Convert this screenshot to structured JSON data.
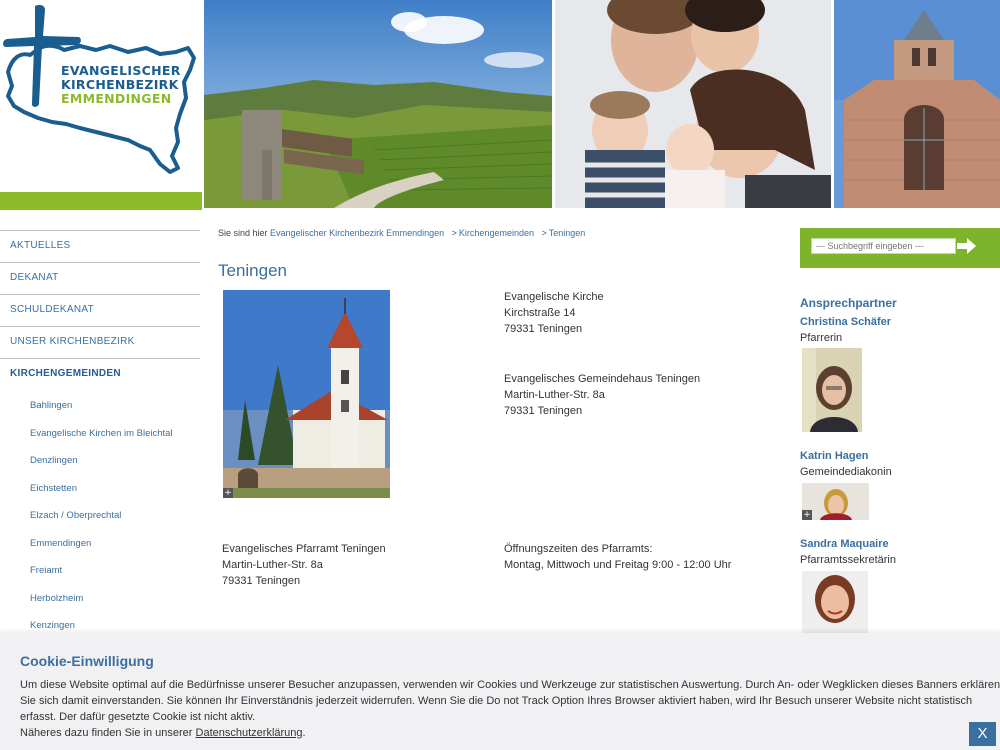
{
  "logo": {
    "line1": "EVANGELISCHER",
    "line2": "KIRCHENBEZIRK",
    "line3": "EMMENDINGEN"
  },
  "nav": {
    "items": [
      {
        "label": "AKTUELLES"
      },
      {
        "label": "DEKANAT"
      },
      {
        "label": "SCHULDEKANAT"
      },
      {
        "label": "UNSER KIRCHENBEZIRK"
      },
      {
        "label": "KIRCHENGEMEINDEN",
        "active": true
      }
    ],
    "subitems": [
      {
        "label": "Bahlingen"
      },
      {
        "label": "Evangelische Kirchen im Bleichtal"
      },
      {
        "label": "Denzlingen"
      },
      {
        "label": "Eichstetten"
      },
      {
        "label": "Elzach / Oberprechtal"
      },
      {
        "label": "Emmendingen"
      },
      {
        "label": "Freiamt"
      },
      {
        "label": "Herbolzheim"
      },
      {
        "label": "Kenzingen"
      }
    ]
  },
  "breadcrumb": {
    "prefix": "Sie sind hier",
    "items": [
      "Evangelischer Kirchenbezirk Emmendingen",
      "Kirchengemeinden",
      "Teningen"
    ],
    "separator": ">"
  },
  "main": {
    "title": "Teningen",
    "church": {
      "name": "Evangelische Kirche",
      "street": "Kirchstraße 14",
      "city": "79331 Teningen"
    },
    "gemeindehaus": {
      "name": "Evangelisches Gemeindehaus Teningen",
      "street": "Martin-Luther-Str. 8a",
      "city": "79331 Teningen"
    },
    "pfarramt": {
      "name": "Evangelisches Pfarramt Teningen",
      "street": "Martin-Luther-Str. 8a",
      "city": "79331 Teningen"
    },
    "hours": {
      "label": "Öffnungszeiten des Pfarramts:",
      "value": "Montag, Mittwoch und Freitag 9:00 - 12:00 Uhr"
    }
  },
  "search": {
    "placeholder": "--- Suchbegriff eingeben ---"
  },
  "contacts": {
    "heading": "Ansprechpartner",
    "people": [
      {
        "name": "Christina Schäfer",
        "role": "Pfarrerin"
      },
      {
        "name": "Katrin Hagen",
        "role": "Gemeindediakonin"
      },
      {
        "name": "Sandra Maquaire",
        "role": "Pfarramtssekretärin"
      }
    ]
  },
  "cookie": {
    "title": "Cookie-Einwilligung",
    "line1": "Um diese Website optimal auf die Bedürfnisse unserer Besucher anzupassen, verwenden wir Cookies und Werkzeuge zur statistischen Auswertung. Durch An- oder Wegklicken dieses Banners erklären Sie sich damit einverstanden. Sie können Ihr Einverständnis jederzeit widerrufen. Wenn Sie die Do not Track Option Ihres Browser aktiviert haben, wird Ihr Besuch unserer Website nicht statistisch erfasst. Der dafür gesetzte Cookie ist nicht aktiv.",
    "line2_prefix": "Näheres dazu finden Sie in unserer",
    "link": "Datenschutzerklärung",
    "line2_suffix": ".",
    "close": "X"
  },
  "colors": {
    "accent_blue": "#3a6fa0",
    "brand_green": "#8bbb2b",
    "search_green": "#7db42c"
  }
}
